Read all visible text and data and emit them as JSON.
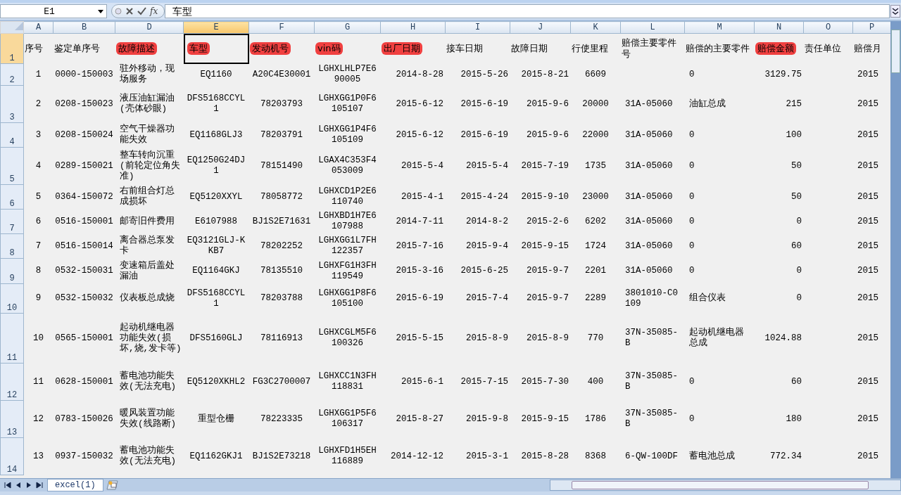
{
  "formula_bar": {
    "name_box": "E1",
    "function_label": "fx",
    "content": "车型"
  },
  "columns": [
    {
      "letter": "A",
      "selected": false
    },
    {
      "letter": "B",
      "selected": false
    },
    {
      "letter": "D",
      "selected": false
    },
    {
      "letter": "E",
      "selected": true
    },
    {
      "letter": "F",
      "selected": false
    },
    {
      "letter": "G",
      "selected": false
    },
    {
      "letter": "H",
      "selected": false
    },
    {
      "letter": "I",
      "selected": false
    },
    {
      "letter": "J",
      "selected": false
    },
    {
      "letter": "K",
      "selected": false
    },
    {
      "letter": "L",
      "selected": false
    },
    {
      "letter": "M",
      "selected": false
    },
    {
      "letter": "N",
      "selected": false
    },
    {
      "letter": "O",
      "selected": false
    },
    {
      "letter": "P",
      "selected": false
    }
  ],
  "header_row": {
    "number": "1",
    "selected": true,
    "cells": [
      {
        "text": "序号",
        "redacted": false
      },
      {
        "text": "鉴定单序号",
        "redacted": false
      },
      {
        "text": "故障描述",
        "redacted": true
      },
      {
        "text": "车型",
        "redacted": true
      },
      {
        "text": "发动机号",
        "redacted": true
      },
      {
        "text": "vin码",
        "redacted": true
      },
      {
        "text": "出厂日期",
        "redacted": true
      },
      {
        "text": "接车日期",
        "redacted": false
      },
      {
        "text": "故障日期",
        "redacted": false
      },
      {
        "text": "行使里程",
        "redacted": false
      },
      {
        "text": "赔偿主要零件号",
        "redacted": false
      },
      {
        "text": "赔偿的主要零件",
        "redacted": false
      },
      {
        "text": "赔偿金额",
        "redacted": true
      },
      {
        "text": "责任单位",
        "redacted": false
      },
      {
        "text": "赔偿月",
        "redacted": false
      }
    ]
  },
  "rows": [
    {
      "number": "2",
      "selected": false,
      "cells": {
        "A": "1",
        "B": "0000-150003",
        "D": "驻外移动，现场服务",
        "E": "EQ1160",
        "F": "A20C4E30001",
        "G": "LGHXLHLP7E690005",
        "H": "2014-8-28",
        "I": "2015-5-26",
        "J": "2015-8-21",
        "K": "6609",
        "M": "0",
        "N": "3129.75",
        "P": "2015"
      }
    },
    {
      "number": "3",
      "selected": false,
      "cells": {
        "A": "2",
        "B": "0208-150023",
        "D": "液压油缸漏油(壳体砂眼)",
        "E": "DFS5168CCYL1",
        "F": "78203793",
        "G": "LGHXGG1P0F6105107",
        "H": "2015-6-12",
        "I": "2015-6-19",
        "J": "2015-9-6",
        "K": "20000",
        "L": "31A-05060",
        "M": "油缸总成",
        "N": "215",
        "P": "2015"
      }
    },
    {
      "number": "4",
      "selected": false,
      "cells": {
        "A": "3",
        "B": "0208-150024",
        "D": "空气干燥器功能失效",
        "E": "EQ1168GLJ3",
        "F": "78203791",
        "G": "LGHXGG1P4F6105109",
        "H": "2015-6-12",
        "I": "2015-6-19",
        "J": "2015-9-6",
        "K": "22000",
        "L": "31A-05060",
        "M": "0",
        "N": "100",
        "P": "2015"
      }
    },
    {
      "number": "5",
      "selected": false,
      "cells": {
        "A": "4",
        "B": "0289-150021",
        "D": "整车转向沉重(前轮定位角失准)",
        "E": "EQ1250G24DJ1",
        "F": "78151490",
        "G": "LGAX4C353F4053009",
        "H": "2015-5-4",
        "I": "2015-5-4",
        "J": "2015-7-19",
        "K": "1735",
        "L": "31A-05060",
        "M": "0",
        "N": "50",
        "P": "2015"
      }
    },
    {
      "number": "6",
      "selected": false,
      "cells": {
        "A": "5",
        "B": "0364-150072",
        "D": "右前组合灯总成损坏",
        "E": "EQ5120XXYL",
        "F": "78058772",
        "G": "LGHXCD1P2E6110740",
        "H": "2015-4-1",
        "I": "2015-4-24",
        "J": "2015-9-10",
        "K": "23000",
        "L": "31A-05060",
        "M": "0",
        "N": "50",
        "P": "2015"
      }
    },
    {
      "number": "7",
      "selected": false,
      "cells": {
        "A": "6",
        "B": "0516-150001",
        "D": "邮寄旧件费用",
        "E": "E6107988",
        "F": "BJ1S2E71631",
        "G": "LGHXBD1H7E6107988",
        "H": "2014-7-11",
        "I": "2014-8-2",
        "J": "2015-2-6",
        "K": "6202",
        "L": "31A-05060",
        "M": "0",
        "N": "0",
        "P": "2015"
      }
    },
    {
      "number": "8",
      "selected": false,
      "cells": {
        "A": "7",
        "B": "0516-150014",
        "D": "离合器总泵发卡",
        "E": "EQ3121GLJ-KKB7",
        "F": "78202252",
        "G": "LGHXGG1L7FH122357",
        "H": "2015-7-16",
        "I": "2015-9-4",
        "J": "2015-9-15",
        "K": "1724",
        "L": "31A-05060",
        "M": "0",
        "N": "60",
        "P": "2015"
      }
    },
    {
      "number": "9",
      "selected": false,
      "cells": {
        "A": "8",
        "B": "0532-150031",
        "D": "变速箱后盖处漏油",
        "E": "EQ1164GKJ",
        "F": "78135510",
        "G": "LGHXFG1H3FH119549",
        "H": "2015-3-16",
        "I": "2015-6-25",
        "J": "2015-9-7",
        "K": "2201",
        "L": "31A-05060",
        "M": "0",
        "N": "0",
        "P": "2015"
      }
    },
    {
      "number": "10",
      "selected": false,
      "cells": {
        "A": "9",
        "B": "0532-150032",
        "D": "仪表板总成烧",
        "E": "DFS5168CCYL1",
        "F": "78203788",
        "G": "LGHXGG1P8F6105100",
        "H": "2015-6-19",
        "I": "2015-7-4",
        "J": "2015-9-7",
        "K": "2289",
        "L": "3801010-C0109",
        "M": "组合仪表",
        "N": "0",
        "P": "2015"
      }
    },
    {
      "number": "11",
      "selected": false,
      "cells": {
        "A": "10",
        "B": "0565-150001",
        "D": "起动机继电器功能失效(损坏,烧,发卡等)",
        "E": "DFS5160GLJ",
        "F": "78116913",
        "G": "LGHXCGLM5F6100326",
        "H": "2015-5-15",
        "I": "2015-8-9",
        "J": "2015-8-9",
        "K": "770",
        "L": "37N-35085-B",
        "M": "起动机继电器总成",
        "N": "1024.88",
        "P": "2015"
      }
    },
    {
      "number": "12",
      "selected": false,
      "cells": {
        "A": "11",
        "B": "0628-150001",
        "D": "蓄电池功能失效(无法充电)",
        "E": "EQ5120XKHL2",
        "F": "FG3C2700007",
        "G": "LGHXCC1N3FH118831",
        "H": "2015-6-1",
        "I": "2015-7-15",
        "J": "2015-7-30",
        "K": "400",
        "L": "37N-35085-B",
        "M": "0",
        "N": "60",
        "P": "2015"
      }
    },
    {
      "number": "13",
      "selected": false,
      "cells": {
        "A": "12",
        "B": "0783-150026",
        "D": "暖风装置功能失效(线路断)",
        "E": "重型仓栅",
        "F": "78223335",
        "G": "LGHXGG1P5F6106317",
        "H": "2015-8-27",
        "I": "2015-9-8",
        "J": "2015-9-15",
        "K": "1786",
        "L": "37N-35085-B",
        "M": "0",
        "N": "180",
        "P": "2015"
      }
    },
    {
      "number": "14",
      "selected": false,
      "cells": {
        "A": "13",
        "B": "0937-150032",
        "D": "蓄电池功能失效(无法充电)",
        "E": "EQ1162GKJ1",
        "F": "BJ1S2E73218",
        "G": "LGHXFD1H5EH116889",
        "H": "2014-12-12",
        "I": "2015-3-1",
        "J": "2015-8-28",
        "K": "8368",
        "L": "6-QW-100DF",
        "M": "蓄电池总成",
        "N": "772.34",
        "P": "2015"
      }
    }
  ],
  "sheet_tabs": [
    {
      "label": "excel(1)",
      "selected": true
    }
  ]
}
